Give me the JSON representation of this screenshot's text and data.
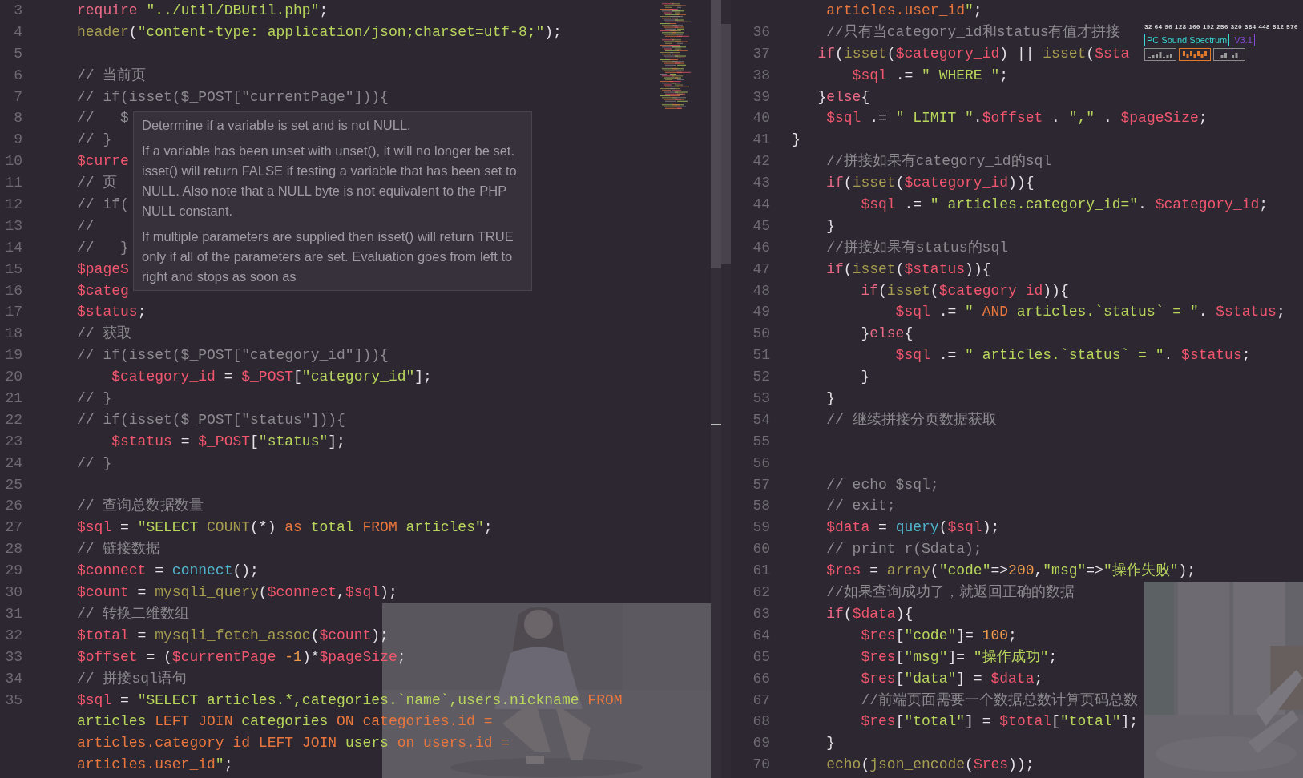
{
  "left_pane": {
    "lines": [
      {
        "number": "3",
        "tokens": [
          {
            "kind": "keyword",
            "text": "require"
          },
          {
            "kind": "string",
            "text": " \"../util/DBUtil.php\""
          },
          {
            "kind": "plain",
            "text": ";"
          }
        ]
      },
      {
        "number": "4",
        "tokens": [
          {
            "kind": "function",
            "text": "header"
          },
          {
            "kind": "plain",
            "text": "("
          },
          {
            "kind": "string",
            "text": "\"content-type: application/json;charset=utf-8;\""
          },
          {
            "kind": "plain",
            "text": ");"
          }
        ]
      },
      {
        "number": "5"
      },
      {
        "number": "6",
        "tokens": [
          {
            "kind": "comment",
            "text": "// 当前页"
          }
        ]
      },
      {
        "number": "7",
        "tokens": [
          {
            "kind": "comment",
            "text": "// if(isset($_POST[\"currentPage\"])){"
          }
        ]
      },
      {
        "number": "8",
        "tokens": [
          {
            "kind": "comment",
            "text": "//   $"
          }
        ]
      },
      {
        "number": "9",
        "tokens": [
          {
            "kind": "comment",
            "text": "// }"
          }
        ]
      },
      {
        "number": "10",
        "tokens": [
          {
            "kind": "variable",
            "text": "$curre"
          }
        ]
      },
      {
        "number": "11",
        "tokens": [
          {
            "kind": "comment",
            "text": "// 页"
          }
        ]
      },
      {
        "number": "12",
        "tokens": [
          {
            "kind": "comment",
            "text": "// if("
          }
        ]
      },
      {
        "number": "13",
        "tokens": [
          {
            "kind": "comment",
            "text": "//"
          }
        ]
      },
      {
        "number": "14",
        "tokens": [
          {
            "kind": "comment",
            "text": "//   }"
          }
        ]
      },
      {
        "number": "15",
        "tokens": [
          {
            "kind": "variable",
            "text": "$pageS"
          }
        ]
      },
      {
        "number": "16",
        "tokens": [
          {
            "kind": "variable",
            "text": "$categ"
          }
        ]
      },
      {
        "number": "17",
        "tokens": [
          {
            "kind": "variable",
            "text": "$status"
          },
          {
            "kind": "plain",
            "text": ";"
          }
        ]
      },
      {
        "number": "18",
        "tokens": [
          {
            "kind": "comment",
            "text": "// 获取"
          }
        ]
      },
      {
        "number": "19",
        "tokens": [
          {
            "kind": "comment",
            "text": "// if(isset($_POST[\"category_id\"])){"
          }
        ]
      },
      {
        "number": "20",
        "tokens": [
          {
            "kind": "variable",
            "text": "    $category_id"
          },
          {
            "kind": "plain",
            "text": " = "
          },
          {
            "kind": "variable",
            "text": "$_POST"
          },
          {
            "kind": "plain",
            "text": "["
          },
          {
            "kind": "string",
            "text": "\"category_id\""
          },
          {
            "kind": "plain",
            "text": "];"
          }
        ]
      },
      {
        "number": "21",
        "tokens": [
          {
            "kind": "comment",
            "text": "// }"
          }
        ]
      },
      {
        "number": "22",
        "tokens": [
          {
            "kind": "comment",
            "text": "// if(isset($_POST[\"status\"])){"
          }
        ]
      },
      {
        "number": "23",
        "tokens": [
          {
            "kind": "variable",
            "text": "    $status"
          },
          {
            "kind": "plain",
            "text": " = "
          },
          {
            "kind": "variable",
            "text": "$_POST"
          },
          {
            "kind": "plain",
            "text": "["
          },
          {
            "kind": "string",
            "text": "\"status\""
          },
          {
            "kind": "plain",
            "text": "];"
          }
        ]
      },
      {
        "number": "24",
        "tokens": [
          {
            "kind": "comment",
            "text": "// }"
          }
        ]
      },
      {
        "number": "25"
      },
      {
        "number": "26",
        "tokens": [
          {
            "kind": "comment",
            "text": "// 查询总数据数量"
          }
        ]
      },
      {
        "number": "27",
        "tokens": [
          {
            "kind": "variable",
            "text": "$sql"
          },
          {
            "kind": "plain",
            "text": " = "
          },
          {
            "kind": "string",
            "text": "\"SELECT "
          },
          {
            "kind": "function",
            "text": "COUNT"
          },
          {
            "kind": "plain",
            "text": "(*) "
          },
          {
            "kind": "sqlkw",
            "text": "as"
          },
          {
            "kind": "string",
            "text": " total "
          },
          {
            "kind": "sqlkw",
            "text": "FROM"
          },
          {
            "kind": "string",
            "text": " articles\""
          },
          {
            "kind": "plain",
            "text": ";"
          }
        ]
      },
      {
        "number": "28",
        "tokens": [
          {
            "kind": "comment",
            "text": "// 链接数据"
          }
        ]
      },
      {
        "number": "29",
        "tokens": [
          {
            "kind": "variable",
            "text": "$connect"
          },
          {
            "kind": "plain",
            "text": " = "
          },
          {
            "kind": "builtin",
            "text": "connect"
          },
          {
            "kind": "plain",
            "text": "();"
          }
        ]
      },
      {
        "number": "30",
        "tokens": [
          {
            "kind": "variable",
            "text": "$count"
          },
          {
            "kind": "plain",
            "text": " = "
          },
          {
            "kind": "function",
            "text": "mysqli_query"
          },
          {
            "kind": "plain",
            "text": "("
          },
          {
            "kind": "variable",
            "text": "$connect"
          },
          {
            "kind": "plain",
            "text": ","
          },
          {
            "kind": "variable",
            "text": "$sql"
          },
          {
            "kind": "plain",
            "text": ");"
          }
        ]
      },
      {
        "number": "31",
        "tokens": [
          {
            "kind": "comment",
            "text": "// 转换二维数组"
          }
        ]
      },
      {
        "number": "32",
        "tokens": [
          {
            "kind": "variable",
            "text": "$total"
          },
          {
            "kind": "plain",
            "text": " = "
          },
          {
            "kind": "function",
            "text": "mysqli_fetch_assoc"
          },
          {
            "kind": "plain",
            "text": "("
          },
          {
            "kind": "variable",
            "text": "$count"
          },
          {
            "kind": "plain",
            "text": ");"
          }
        ]
      },
      {
        "number": "33",
        "tokens": [
          {
            "kind": "variable",
            "text": "$offset"
          },
          {
            "kind": "plain",
            "text": " = ("
          },
          {
            "kind": "variable",
            "text": "$currentPage"
          },
          {
            "kind": "number",
            "text": " -1"
          },
          {
            "kind": "plain",
            "text": ")*"
          },
          {
            "kind": "variable",
            "text": "$pageSize"
          },
          {
            "kind": "plain",
            "text": ";"
          }
        ]
      },
      {
        "number": "34",
        "tokens": [
          {
            "kind": "comment",
            "text": "// 拼接sql语句"
          }
        ]
      },
      {
        "number": "35",
        "tokens": [
          {
            "kind": "variable",
            "text": "$sql"
          },
          {
            "kind": "plain",
            "text": " = "
          },
          {
            "kind": "string",
            "text": "\"SELECT articles.*,categories.`name`,users.nickname "
          },
          {
            "kind": "sqlkw",
            "text": "FROM"
          }
        ]
      },
      {
        "tokens": [
          {
            "kind": "string",
            "text": "articles "
          },
          {
            "kind": "sqlkw",
            "text": "LEFT JOIN"
          },
          {
            "kind": "string",
            "text": " categories "
          },
          {
            "kind": "sqlkw",
            "text": "ON"
          },
          {
            "kind": "sqlkw",
            "text": " categories.id ="
          }
        ]
      },
      {
        "tokens": [
          {
            "kind": "sqlkw",
            "text": "articles.category_id"
          },
          {
            "kind": "sqlkw",
            "text": " LEFT JOIN"
          },
          {
            "kind": "string",
            "text": " users "
          },
          {
            "kind": "sqlkw",
            "text": "on"
          },
          {
            "kind": "sqlkw",
            "text": " users.id ="
          }
        ]
      },
      {
        "tokens": [
          {
            "kind": "sqlkw",
            "text": "articles.user_id"
          },
          {
            "kind": "string",
            "text": "\""
          },
          {
            "kind": "plain",
            "text": ";"
          }
        ]
      }
    ],
    "tooltip": {
      "paragraphs": [
        "Determine if a variable is set and is not NULL.",
        "If a variable has been unset with unset(), it will no longer be set. isset() will return FALSE if testing a variable that has been set to NULL. Also note that a NULL byte is not equivalent to the PHP NULL constant.",
        "If multiple parameters are supplied then isset() will return TRUE only if all of the parameters are set. Evaluation goes from left to right and stops as soon as"
      ]
    }
  },
  "right_pane": {
    "lines": [
      {
        "tokens": [
          {
            "kind": "sqlkw",
            "text": "    articles.user_id"
          },
          {
            "kind": "string",
            "text": "\""
          },
          {
            "kind": "plain",
            "text": ";"
          }
        ]
      },
      {
        "number": "36",
        "tokens": [
          {
            "kind": "comment",
            "text": "    //只有当category_id和status有值才拼接"
          }
        ]
      },
      {
        "number": "37",
        "tokens": [
          {
            "kind": "keyword",
            "text": "   if"
          },
          {
            "kind": "plain",
            "text": "("
          },
          {
            "kind": "function",
            "text": "isset"
          },
          {
            "kind": "plain",
            "text": "("
          },
          {
            "kind": "variable",
            "text": "$category_id"
          },
          {
            "kind": "plain",
            "text": ") || "
          },
          {
            "kind": "function",
            "text": "isset"
          },
          {
            "kind": "plain",
            "text": "("
          },
          {
            "kind": "variable",
            "text": "$sta"
          }
        ]
      },
      {
        "number": "38",
        "tokens": [
          {
            "kind": "variable",
            "text": "       $sql"
          },
          {
            "kind": "plain",
            "text": " .= "
          },
          {
            "kind": "string",
            "text": "\" WHERE \""
          },
          {
            "kind": "plain",
            "text": ";"
          }
        ]
      },
      {
        "number": "39",
        "tokens": [
          {
            "kind": "plain",
            "text": "   }"
          },
          {
            "kind": "keyword",
            "text": "else"
          },
          {
            "kind": "plain",
            "text": "{"
          }
        ]
      },
      {
        "number": "40",
        "tokens": [
          {
            "kind": "variable",
            "text": "    $sql"
          },
          {
            "kind": "plain",
            "text": " .= "
          },
          {
            "kind": "string",
            "text": "\" LIMIT \""
          },
          {
            "kind": "plain",
            "text": "."
          },
          {
            "kind": "variable",
            "text": "$offset"
          },
          {
            "kind": "plain",
            "text": " . "
          },
          {
            "kind": "string",
            "text": "\",\""
          },
          {
            "kind": "plain",
            "text": " . "
          },
          {
            "kind": "variable",
            "text": "$pageSize"
          },
          {
            "kind": "plain",
            "text": ";"
          }
        ]
      },
      {
        "number": "41",
        "tokens": [
          {
            "kind": "plain",
            "text": "}"
          }
        ]
      },
      {
        "number": "42",
        "tokens": [
          {
            "kind": "comment",
            "text": "    //拼接如果有category_id的sql"
          }
        ]
      },
      {
        "number": "43",
        "tokens": [
          {
            "kind": "keyword",
            "text": "    if"
          },
          {
            "kind": "plain",
            "text": "("
          },
          {
            "kind": "function",
            "text": "isset"
          },
          {
            "kind": "plain",
            "text": "("
          },
          {
            "kind": "variable",
            "text": "$category_id"
          },
          {
            "kind": "plain",
            "text": ")){"
          }
        ]
      },
      {
        "number": "44",
        "tokens": [
          {
            "kind": "variable",
            "text": "        $sql"
          },
          {
            "kind": "plain",
            "text": " .= "
          },
          {
            "kind": "string",
            "text": "\" articles.category_id=\""
          },
          {
            "kind": "plain",
            "text": ". "
          },
          {
            "kind": "variable",
            "text": "$category_id"
          },
          {
            "kind": "plain",
            "text": ";"
          }
        ]
      },
      {
        "number": "45",
        "tokens": [
          {
            "kind": "plain",
            "text": "    }"
          }
        ]
      },
      {
        "number": "46",
        "tokens": [
          {
            "kind": "comment",
            "text": "    //拼接如果有status的sql"
          }
        ]
      },
      {
        "number": "47",
        "tokens": [
          {
            "kind": "keyword",
            "text": "    if"
          },
          {
            "kind": "plain",
            "text": "("
          },
          {
            "kind": "function",
            "text": "isset"
          },
          {
            "kind": "plain",
            "text": "("
          },
          {
            "kind": "variable",
            "text": "$status"
          },
          {
            "kind": "plain",
            "text": ")){"
          }
        ]
      },
      {
        "number": "48",
        "tokens": [
          {
            "kind": "keyword",
            "text": "        if"
          },
          {
            "kind": "plain",
            "text": "("
          },
          {
            "kind": "function",
            "text": "isset"
          },
          {
            "kind": "plain",
            "text": "("
          },
          {
            "kind": "variable",
            "text": "$category_id"
          },
          {
            "kind": "plain",
            "text": ")){"
          }
        ]
      },
      {
        "number": "49",
        "tokens": [
          {
            "kind": "variable",
            "text": "            $sql"
          },
          {
            "kind": "plain",
            "text": " .= "
          },
          {
            "kind": "string",
            "text": "\" "
          },
          {
            "kind": "sqlkw",
            "text": "AND"
          },
          {
            "kind": "string",
            "text": " articles.`status` = \""
          },
          {
            "kind": "plain",
            "text": ". "
          },
          {
            "kind": "variable",
            "text": "$status"
          },
          {
            "kind": "plain",
            "text": ";"
          }
        ]
      },
      {
        "number": "50",
        "tokens": [
          {
            "kind": "plain",
            "text": "        }"
          },
          {
            "kind": "keyword",
            "text": "else"
          },
          {
            "kind": "plain",
            "text": "{"
          }
        ]
      },
      {
        "number": "51",
        "tokens": [
          {
            "kind": "variable",
            "text": "            $sql"
          },
          {
            "kind": "plain",
            "text": " .= "
          },
          {
            "kind": "string",
            "text": "\" articles.`status` = \""
          },
          {
            "kind": "plain",
            "text": ". "
          },
          {
            "kind": "variable",
            "text": "$status"
          },
          {
            "kind": "plain",
            "text": ";"
          }
        ]
      },
      {
        "number": "52",
        "tokens": [
          {
            "kind": "plain",
            "text": "        }"
          }
        ]
      },
      {
        "number": "53",
        "tokens": [
          {
            "kind": "plain",
            "text": "    }"
          }
        ]
      },
      {
        "number": "54",
        "tokens": [
          {
            "kind": "comment",
            "text": "    // 继续拼接分页数据获取"
          }
        ]
      },
      {
        "number": "55"
      },
      {
        "number": "56"
      },
      {
        "number": "57",
        "tokens": [
          {
            "kind": "comment",
            "text": "    // echo $sql;"
          }
        ]
      },
      {
        "number": "58",
        "tokens": [
          {
            "kind": "comment",
            "text": "    // exit;"
          }
        ]
      },
      {
        "number": "59",
        "tokens": [
          {
            "kind": "variable",
            "text": "    $data"
          },
          {
            "kind": "plain",
            "text": " = "
          },
          {
            "kind": "builtin",
            "text": "query"
          },
          {
            "kind": "plain",
            "text": "("
          },
          {
            "kind": "variable",
            "text": "$sql"
          },
          {
            "kind": "plain",
            "text": ");"
          }
        ]
      },
      {
        "number": "60",
        "tokens": [
          {
            "kind": "comment",
            "text": "    // print_r($data);"
          }
        ]
      },
      {
        "number": "61",
        "tokens": [
          {
            "kind": "variable",
            "text": "    $res"
          },
          {
            "kind": "plain",
            "text": " = "
          },
          {
            "kind": "function",
            "text": "array"
          },
          {
            "kind": "plain",
            "text": "("
          },
          {
            "kind": "string",
            "text": "\"code\""
          },
          {
            "kind": "plain",
            "text": "=>"
          },
          {
            "kind": "number",
            "text": "200"
          },
          {
            "kind": "plain",
            "text": ","
          },
          {
            "kind": "string",
            "text": "\"msg\""
          },
          {
            "kind": "plain",
            "text": "=>"
          },
          {
            "kind": "string",
            "text": "\"操作失败\""
          },
          {
            "kind": "plain",
            "text": ");"
          }
        ]
      },
      {
        "number": "62",
        "tokens": [
          {
            "kind": "comment",
            "text": "    //如果查询成功了，就返回正确的数据"
          }
        ]
      },
      {
        "number": "63",
        "tokens": [
          {
            "kind": "keyword",
            "text": "    if"
          },
          {
            "kind": "plain",
            "text": "("
          },
          {
            "kind": "variable",
            "text": "$data"
          },
          {
            "kind": "plain",
            "text": "){"
          }
        ]
      },
      {
        "number": "64",
        "tokens": [
          {
            "kind": "variable",
            "text": "        $res"
          },
          {
            "kind": "plain",
            "text": "["
          },
          {
            "kind": "string",
            "text": "\"code\""
          },
          {
            "kind": "plain",
            "text": "]= "
          },
          {
            "kind": "number",
            "text": "100"
          },
          {
            "kind": "plain",
            "text": ";"
          }
        ]
      },
      {
        "number": "65",
        "tokens": [
          {
            "kind": "variable",
            "text": "        $res"
          },
          {
            "kind": "plain",
            "text": "["
          },
          {
            "kind": "string",
            "text": "\"msg\""
          },
          {
            "kind": "plain",
            "text": "]= "
          },
          {
            "kind": "string",
            "text": "\"操作成功\""
          },
          {
            "kind": "plain",
            "text": ";"
          }
        ]
      },
      {
        "number": "66",
        "tokens": [
          {
            "kind": "variable",
            "text": "        $res"
          },
          {
            "kind": "plain",
            "text": "["
          },
          {
            "kind": "string",
            "text": "\"data\""
          },
          {
            "kind": "plain",
            "text": "] = "
          },
          {
            "kind": "variable",
            "text": "$data"
          },
          {
            "kind": "plain",
            "text": ";"
          }
        ]
      },
      {
        "number": "67",
        "tokens": [
          {
            "kind": "comment",
            "text": "        //前端页面需要一个数据总数计算页码总数"
          }
        ]
      },
      {
        "number": "68",
        "tokens": [
          {
            "kind": "variable",
            "text": "        $res"
          },
          {
            "kind": "plain",
            "text": "["
          },
          {
            "kind": "string",
            "text": "\"total\""
          },
          {
            "kind": "plain",
            "text": "] = "
          },
          {
            "kind": "variable",
            "text": "$total"
          },
          {
            "kind": "plain",
            "text": "["
          },
          {
            "kind": "string",
            "text": "\"total\""
          },
          {
            "kind": "plain",
            "text": "];"
          }
        ]
      },
      {
        "number": "69",
        "tokens": [
          {
            "kind": "plain",
            "text": "    }"
          }
        ]
      },
      {
        "number": "70",
        "tokens": [
          {
            "kind": "function",
            "text": "    echo"
          },
          {
            "kind": "plain",
            "text": "("
          },
          {
            "kind": "function",
            "text": "json_encode"
          },
          {
            "kind": "plain",
            "text": "("
          },
          {
            "kind": "variable",
            "text": "$res"
          },
          {
            "kind": "plain",
            "text": "));"
          }
        ]
      }
    ]
  },
  "spectrum_widget": {
    "scale": [
      "32",
      "64",
      "96",
      "128",
      "160",
      "192",
      "256",
      "320",
      "384",
      "448",
      "512",
      "576"
    ],
    "title": "PC Sound Spectrum",
    "version": "V3.1"
  }
}
